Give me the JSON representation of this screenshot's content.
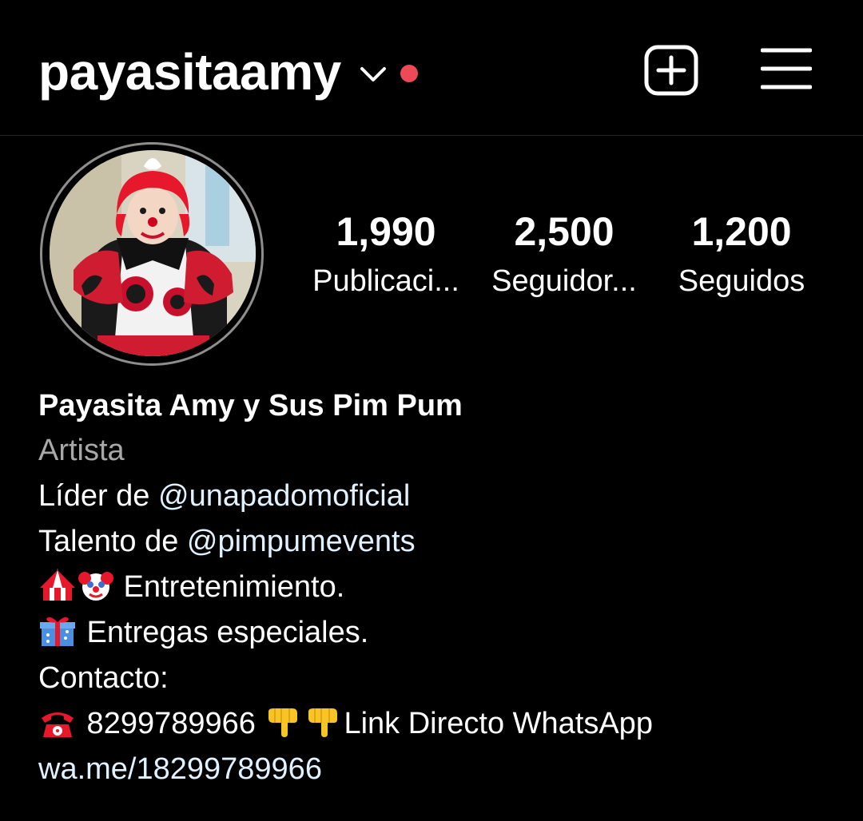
{
  "header": {
    "username": "payasitaamy",
    "has_notification": true,
    "accent_color": "#ed4956",
    "icons": [
      "chevron-down-icon",
      "plus-square-icon",
      "hamburger-menu-icon"
    ]
  },
  "profile": {
    "avatar_alt": "profile picture"
  },
  "stats": {
    "posts_value": "1,990",
    "posts_label": "Publicaci...",
    "followers_value": "2,500",
    "followers_label": "Seguidor...",
    "following_value": "1,200",
    "following_label": "Seguidos"
  },
  "bio": {
    "name": "Payasita Amy y Sus Pim Pum",
    "category": "Artista",
    "line1_prefix": "Líder de ",
    "line1_mention": "@unapadomoficial",
    "line2_prefix": "Talento de ",
    "line2_mention": "@pimpumevents",
    "line3_text": " Entretenimiento.",
    "line4_text": " Entregas especiales.",
    "line5_text": "Contacto:",
    "line6_phone": " 8299789966 ",
    "line6_text": "Link Directo WhatsApp",
    "link": "wa.me/18299789966",
    "link_color": "#e0f1ff",
    "category_color": "#a8a8a8"
  }
}
